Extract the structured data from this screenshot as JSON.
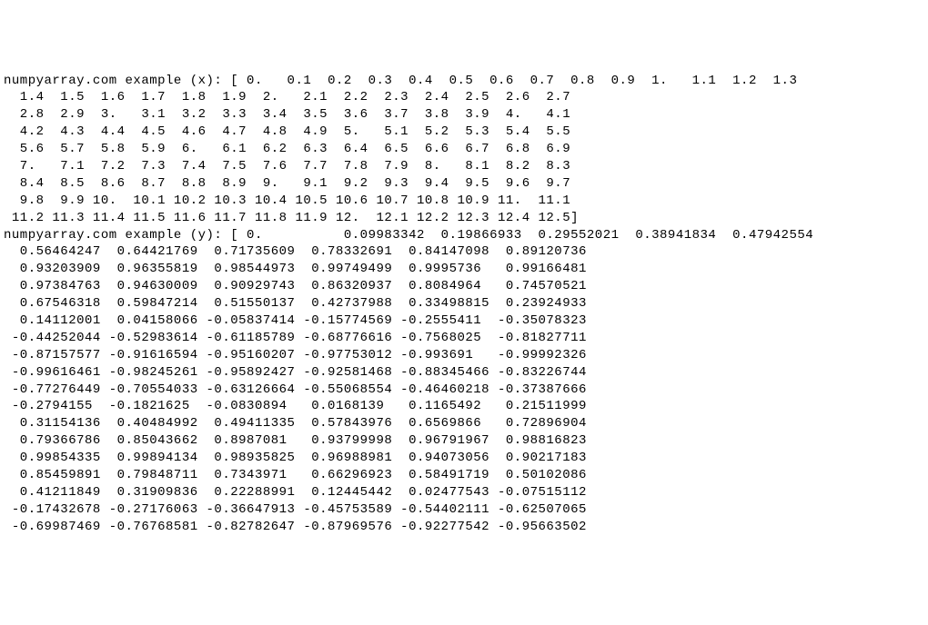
{
  "label_x": "numpyarray.com example (x): ",
  "label_y": "numpyarray.com example (y): ",
  "x_lines": [
    "[ 0.   0.1  0.2  0.3  0.4  0.5  0.6  0.7  0.8  0.9  1.   1.1  1.2  1.3",
    "  1.4  1.5  1.6  1.7  1.8  1.9  2.   2.1  2.2  2.3  2.4  2.5  2.6  2.7",
    "  2.8  2.9  3.   3.1  3.2  3.3  3.4  3.5  3.6  3.7  3.8  3.9  4.   4.1",
    "  4.2  4.3  4.4  4.5  4.6  4.7  4.8  4.9  5.   5.1  5.2  5.3  5.4  5.5",
    "  5.6  5.7  5.8  5.9  6.   6.1  6.2  6.3  6.4  6.5  6.6  6.7  6.8  6.9",
    "  7.   7.1  7.2  7.3  7.4  7.5  7.6  7.7  7.8  7.9  8.   8.1  8.2  8.3",
    "  8.4  8.5  8.6  8.7  8.8  8.9  9.   9.1  9.2  9.3  9.4  9.5  9.6  9.7",
    "  9.8  9.9 10.  10.1 10.2 10.3 10.4 10.5 10.6 10.7 10.8 10.9 11.  11.1",
    " 11.2 11.3 11.4 11.5 11.6 11.7 11.8 11.9 12.  12.1 12.2 12.3 12.4 12.5]"
  ],
  "y_lines": [
    "[ 0.          0.09983342  0.19866933  0.29552021  0.38941834  0.47942554",
    "  0.56464247  0.64421769  0.71735609  0.78332691  0.84147098  0.89120736",
    "  0.93203909  0.96355819  0.98544973  0.99749499  0.9995736   0.99166481",
    "  0.97384763  0.94630009  0.90929743  0.86320937  0.8084964   0.74570521",
    "  0.67546318  0.59847214  0.51550137  0.42737988  0.33498815  0.23924933",
    "  0.14112001  0.04158066 -0.05837414 -0.15774569 -0.2555411  -0.35078323",
    " -0.44252044 -0.52983614 -0.61185789 -0.68776616 -0.7568025  -0.81827711",
    " -0.87157577 -0.91616594 -0.95160207 -0.97753012 -0.993691   -0.99992326",
    " -0.99616461 -0.98245261 -0.95892427 -0.92581468 -0.88345466 -0.83226744",
    " -0.77276449 -0.70554033 -0.63126664 -0.55068554 -0.46460218 -0.37387666",
    " -0.2794155  -0.1821625  -0.0830894   0.0168139   0.1165492   0.21511999",
    "  0.31154136  0.40484992  0.49411335  0.57843976  0.6569866   0.72896904",
    "  0.79366786  0.85043662  0.8987081   0.93799998  0.96791967  0.98816823",
    "  0.99854335  0.99894134  0.98935825  0.96988981  0.94073056  0.90217183",
    "  0.85459891  0.79848711  0.7343971   0.66296923  0.58491719  0.50102086",
    "  0.41211849  0.31909836  0.22288991  0.12445442  0.02477543 -0.07515112",
    " -0.17432678 -0.27176063 -0.36647913 -0.45753589 -0.54402111 -0.62507065",
    " -0.69987469 -0.76768581 -0.82782647 -0.87969576 -0.92277542 -0.95663502"
  ]
}
